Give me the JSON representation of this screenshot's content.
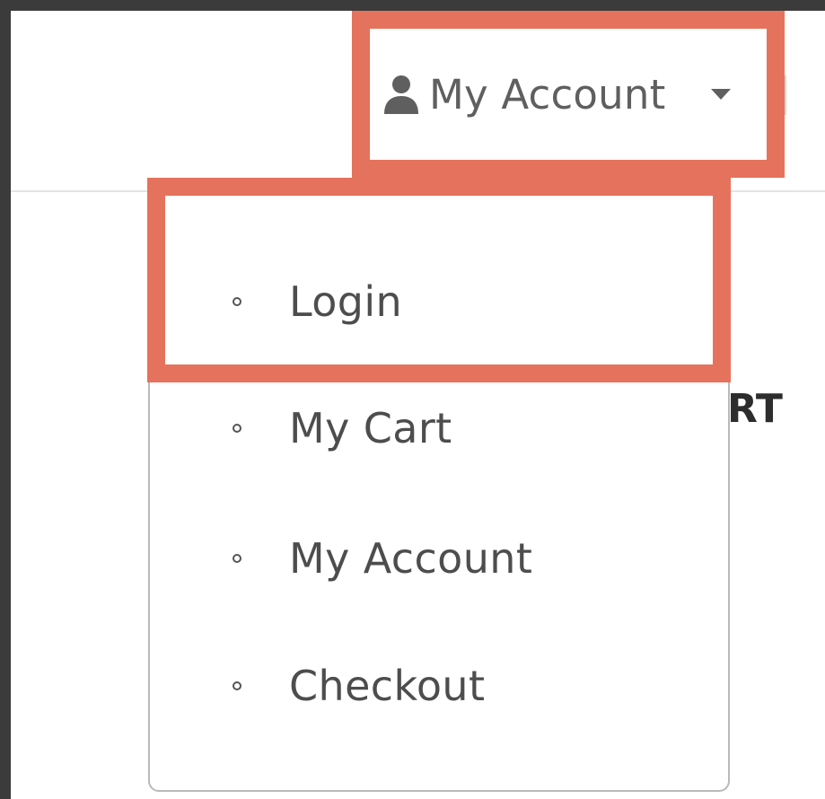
{
  "header": {
    "account_toggle": {
      "label": "My Account",
      "icon": "user-icon",
      "caret_icon": "caret-down-icon"
    }
  },
  "background": {
    "partial_text": "RT"
  },
  "dropdown": {
    "items": [
      {
        "label": "Login"
      },
      {
        "label": "My Cart"
      },
      {
        "label": "My Account"
      },
      {
        "label": "Checkout"
      }
    ]
  },
  "colors": {
    "highlight": "#e5725c",
    "text": "#4d4d4d",
    "frame": "#3b3b3b"
  }
}
